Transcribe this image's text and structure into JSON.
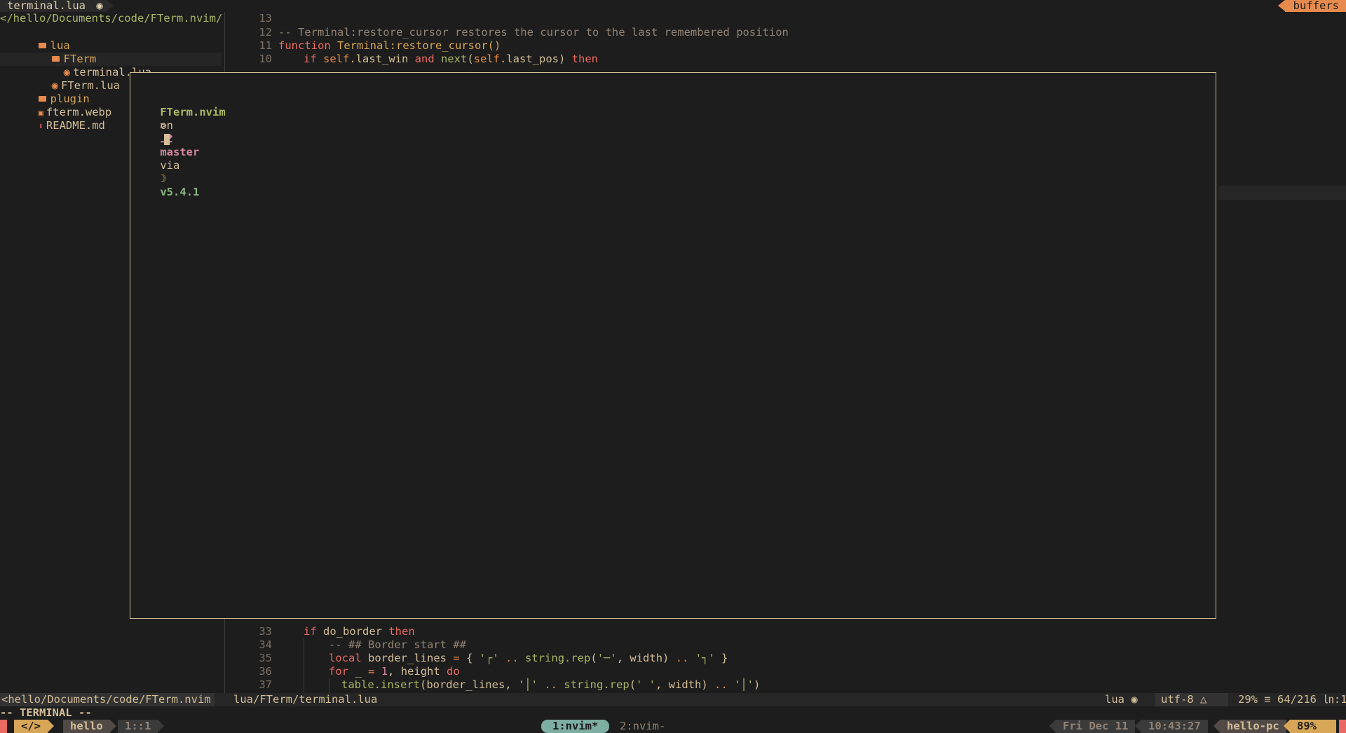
{
  "tabline": {
    "active_tab": "terminal.lua",
    "buffers_label": "buffers"
  },
  "tree": {
    "root": "</hello/Documents/code/FTerm.nvim/",
    "items": [
      {
        "name": "lua",
        "kind": "dir"
      },
      {
        "name": "FTerm",
        "kind": "dir"
      },
      {
        "name": "terminal.lua",
        "kind": "lua"
      },
      {
        "name": "FTerm.lua",
        "kind": "lua"
      },
      {
        "name": "plugin",
        "kind": "dir"
      },
      {
        "name": "fterm.webp",
        "kind": "image"
      },
      {
        "name": "README.md",
        "kind": "markdown"
      }
    ]
  },
  "code_top": {
    "lines": [
      {
        "num": "13",
        "text": ""
      },
      {
        "num": "12",
        "text": "-- Terminal:restore_cursor restores the cursor to the last remembered position"
      },
      {
        "num": "11",
        "kw": "function",
        "name": "Terminal:restore_cursor()"
      },
      {
        "num": "10",
        "text": "if self.last_win and next(self.last_pos) then"
      }
    ]
  },
  "terminal": {
    "dir": "FTerm.nvim",
    "on": "on",
    "branch_icon": "⎇",
    "branch": "master",
    "via": "via",
    "lua_icon": "☽",
    "version": "v5.4.1",
    "prompt": ">"
  },
  "code_bottom": {
    "lines": [
      {
        "num": "33",
        "text": "if do_border then"
      },
      {
        "num": "34",
        "text": "-- ## Border start ##"
      },
      {
        "num": "35",
        "text": "local border_lines = { '┌' .. string.rep('─', width) .. '┐' }"
      },
      {
        "num": "36",
        "text": "for _ = 1, height do"
      },
      {
        "num": "37",
        "text": "table.insert(border_lines, '│' .. string.rep(' ', width) .. '│')"
      }
    ]
  },
  "statusline": {
    "tree_path": "<hello/Documents/code/FTerm.nvim",
    "file_path": "lua/FTerm/terminal.lua",
    "filetype": "lua",
    "encoding": "utf-8",
    "position": "29% ≡ 64/216 ㏑:1"
  },
  "mode": "-- TERMINAL --",
  "tmux": {
    "code_icon": "</>",
    "session": "hello",
    "pane": "1::1",
    "win_active": "1:nvim*",
    "win_other": "2:nvim-",
    "date": "Fri Dec 11",
    "time": "10:43:27",
    "host": "hello-pc",
    "battery": "89%"
  },
  "colors": {
    "accent": "#d8a657",
    "orange": "#e78a4e",
    "red": "#ea6962",
    "green": "#a9b665",
    "blue": "#7daea3"
  }
}
